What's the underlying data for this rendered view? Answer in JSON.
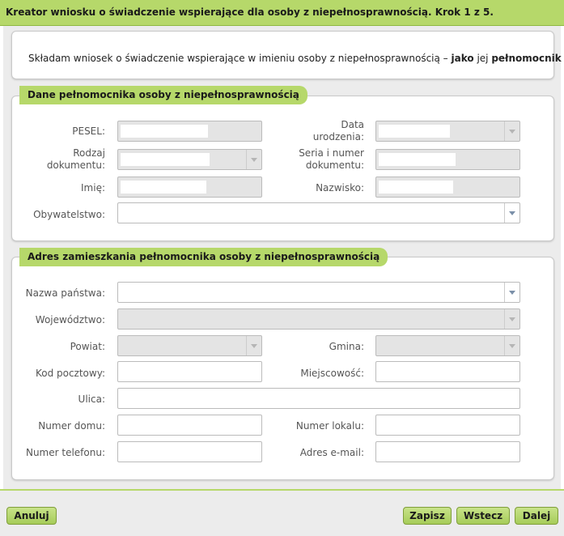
{
  "title": "Kreator wniosku o świadczenie wspierające dla osoby z niepełnosprawnością. Krok 1 z 5.",
  "intro": {
    "text_prefix": "Składam wniosek o świadczenie wspierające  w imieniu osoby z niepełnosprawnością – ",
    "bold1": "jako",
    "text_mid": " jej ",
    "bold2": "pełnomocnik"
  },
  "section1": {
    "title": "Dane pełnomocnika osoby z niepełnosprawnością",
    "pesel_label": "PESEL:",
    "birthdate_label_1": "Data",
    "birthdate_label_2": "urodzenia:",
    "doctype_label_1": "Rodzaj",
    "doctype_label_2": "dokumentu:",
    "docnum_label_1": "Seria i numer",
    "docnum_label_2": "dokumentu:",
    "firstname_label": "Imię:",
    "lastname_label": "Nazwisko:",
    "citizenship_label": "Obywatelstwo:"
  },
  "section2": {
    "title": "Adres zamieszkania pełnomocnika osoby z niepełnosprawnością",
    "country_label": "Nazwa państwa:",
    "voivodeship_label": "Województwo:",
    "county_label": "Powiat:",
    "commune_label": "Gmina:",
    "postal_label": "Kod pocztowy:",
    "city_label": "Miejscowość:",
    "street_label": "Ulica:",
    "house_label": "Numer domu:",
    "flat_label": "Numer lokalu:",
    "phone_label": "Numer telefonu:",
    "email_label": "Adres e-mail:"
  },
  "buttons": {
    "cancel": "Anuluj",
    "save": "Zapisz",
    "back": "Wstecz",
    "next": "Dalej"
  },
  "colors": {
    "accent": "#b6d86a",
    "background": "#ececec"
  }
}
